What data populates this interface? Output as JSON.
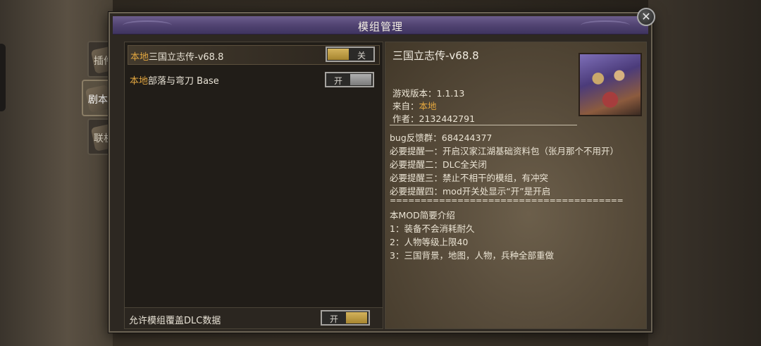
{
  "dialog": {
    "title": "模组管理",
    "close_icon": "close-icon"
  },
  "tabs": [
    {
      "label": "插件",
      "active": false,
      "icon": "scroll-icon"
    },
    {
      "label": "剧本",
      "active": true,
      "icon": "scroll-icon"
    },
    {
      "label": "联机",
      "active": false,
      "icon": "scroll-icon"
    }
  ],
  "mods": [
    {
      "source": "本地",
      "name": "三国立志传-v68.8",
      "toggle_label": "关",
      "selected": true
    },
    {
      "source": "本地",
      "name": "部落与弯刀 Base",
      "toggle_label": "开",
      "selected": false
    }
  ],
  "footer": {
    "label": "允许模组覆盖DLC数据",
    "toggle_label": "开"
  },
  "detail": {
    "title": "三国立志传-v68.8",
    "version_label": "游戏版本：",
    "version_value": "1.1.13",
    "from_label": "来自：",
    "from_value": "本地",
    "author_label": "作者：",
    "author_value": "2132442791",
    "lines": [
      "bug反馈群：684244377",
      "必要提醒一：开启汉家江湖基础资料包（张月那个不用开）",
      "必要提醒二：DLC全关闭",
      "必要提醒三：禁止不相干的模组，有冲突",
      "必要提醒四：mod开关处显示“开”是开启",
      "======================================",
      "本MOD简要介绍",
      "1：装备不会消耗耐久",
      "2：人物等级上限40",
      "3：三国背景，地图，人物，兵种全部重做"
    ]
  },
  "colors": {
    "accent": "#e2a63f",
    "title_bar": "#4f4270",
    "toggle_on": "#c9a84e"
  }
}
